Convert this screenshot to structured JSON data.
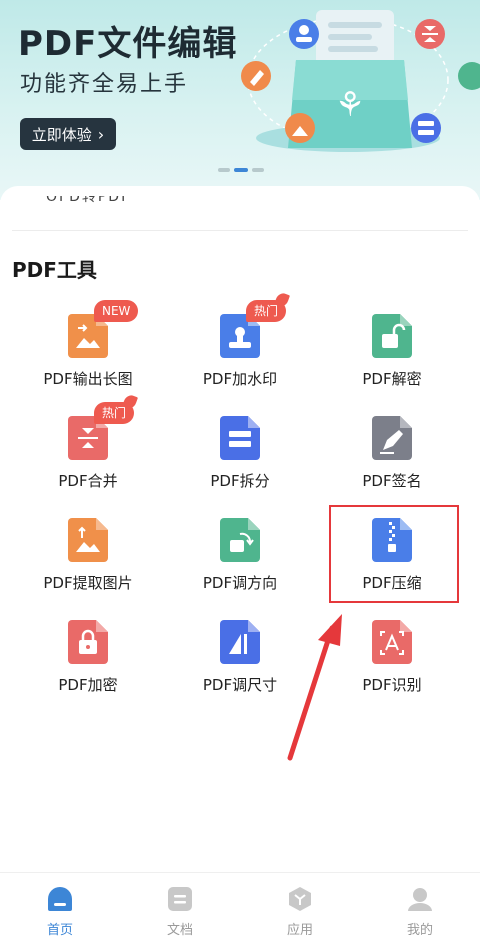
{
  "banner": {
    "title": "PDF文件编辑",
    "subtitle": "功能齐全易上手",
    "button_label": "立即体验",
    "button_chevron": "›"
  },
  "list_clipped_text": "OFD转PDF",
  "tools_section": {
    "title": "PDF工具",
    "items": [
      {
        "label": "PDF输出长图",
        "badge": "NEW",
        "color": "#f0904a",
        "icon": "image-export-icon"
      },
      {
        "label": "PDF加水印",
        "badge": "热门",
        "color": "#4a7ee8",
        "icon": "stamp-icon"
      },
      {
        "label": "PDF解密",
        "badge": "",
        "color": "#4fb58e",
        "icon": "unlock-icon"
      },
      {
        "label": "PDF合并",
        "badge": "热门",
        "color": "#e96a68",
        "icon": "merge-icon"
      },
      {
        "label": "PDF拆分",
        "badge": "",
        "color": "#4a6fe6",
        "icon": "split-icon"
      },
      {
        "label": "PDF签名",
        "badge": "",
        "color": "#7c7f8a",
        "icon": "pen-sign-icon"
      },
      {
        "label": "PDF提取图片",
        "badge": "",
        "color": "#f0904a",
        "icon": "extract-image-icon"
      },
      {
        "label": "PDF调方向",
        "badge": "",
        "color": "#4fb58e",
        "icon": "rotate-icon"
      },
      {
        "label": "PDF压缩",
        "badge": "",
        "color": "#4a7ee8",
        "icon": "zip-compress-icon"
      },
      {
        "label": "PDF加密",
        "badge": "",
        "color": "#e96a68",
        "icon": "lock-icon"
      },
      {
        "label": "PDF调尺寸",
        "badge": "",
        "color": "#4a6fe6",
        "icon": "resize-icon"
      },
      {
        "label": "PDF识别",
        "badge": "",
        "color": "#e96a68",
        "icon": "ocr-scan-icon"
      }
    ]
  },
  "tabbar": {
    "items": [
      {
        "label": "首页",
        "icon": "home-icon",
        "active": true
      },
      {
        "label": "文档",
        "icon": "document-icon",
        "active": false
      },
      {
        "label": "应用",
        "icon": "apps-cube-icon",
        "active": false
      },
      {
        "label": "我的",
        "icon": "profile-icon",
        "active": false
      }
    ]
  },
  "colors": {
    "accent": "#3d86d6",
    "highlight_annotation": "#e5383b",
    "badge": "#ee5a4f"
  }
}
